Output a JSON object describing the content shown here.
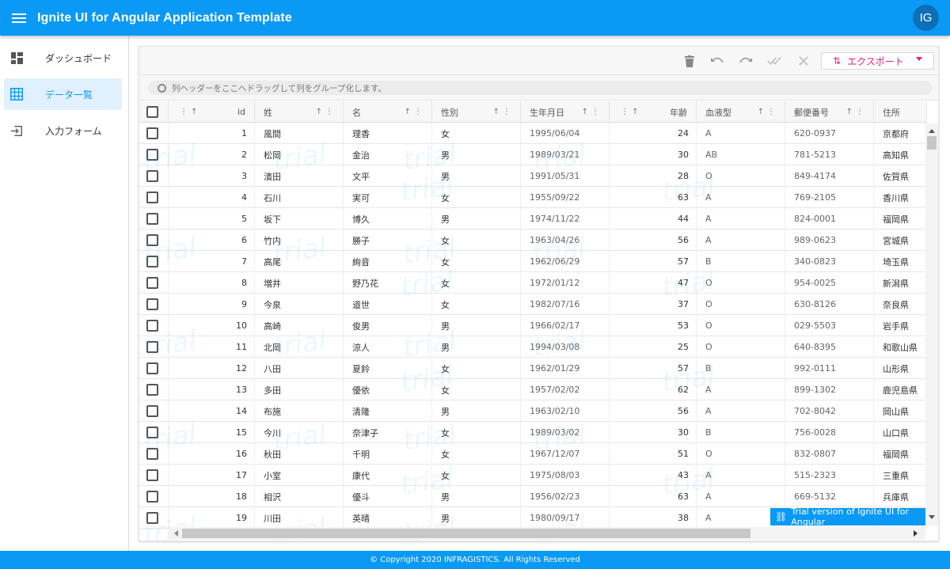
{
  "app": {
    "title": "Ignite UI for Angular Application Template",
    "avatar_initials": "IG"
  },
  "colors": {
    "primary": "#0a99f4",
    "export_accent": "#e41c77",
    "nav_active_bg": "#e1f0fd"
  },
  "sidebar": {
    "items": [
      {
        "label": "ダッシュボード",
        "icon": "dashboard-icon",
        "active": false
      },
      {
        "label": "データ一覧",
        "icon": "grid-icon",
        "active": true
      },
      {
        "label": "入力フォーム",
        "icon": "login-form-icon",
        "active": false
      }
    ]
  },
  "toolbar": {
    "icons": [
      "delete-icon",
      "undo-icon",
      "redo-icon",
      "commit-icon",
      "discard-icon"
    ],
    "export_label": "エクスポート"
  },
  "group_area": {
    "hint": "列ヘッダーをここへドラッグして列をグループ化します。"
  },
  "grid": {
    "columns": [
      {
        "key": "id",
        "label": "id"
      },
      {
        "key": "sei",
        "label": "姓"
      },
      {
        "key": "mei",
        "label": "名"
      },
      {
        "key": "gender",
        "label": "性別"
      },
      {
        "key": "birth",
        "label": "生年月日"
      },
      {
        "key": "age",
        "label": "年齢"
      },
      {
        "key": "blood",
        "label": "血液型"
      },
      {
        "key": "zip",
        "label": "郵便番号"
      },
      {
        "key": "address",
        "label": "住所"
      }
    ],
    "rows": [
      [
        "1",
        "風間",
        "理香",
        "女",
        "1995/06/04",
        "24",
        "A",
        "620-0937",
        "京都府"
      ],
      [
        "2",
        "松岡",
        "金治",
        "男",
        "1989/03/21",
        "30",
        "AB",
        "781-5213",
        "高知県"
      ],
      [
        "3",
        "濱田",
        "文平",
        "男",
        "1991/05/31",
        "28",
        "O",
        "849-4174",
        "佐賀県"
      ],
      [
        "4",
        "石川",
        "実可",
        "女",
        "1955/09/22",
        "63",
        "A",
        "769-2105",
        "香川県"
      ],
      [
        "5",
        "坂下",
        "博久",
        "男",
        "1974/11/22",
        "44",
        "A",
        "824-0001",
        "福岡県"
      ],
      [
        "6",
        "竹内",
        "勝子",
        "女",
        "1963/04/26",
        "56",
        "A",
        "989-0623",
        "宮城県"
      ],
      [
        "7",
        "高尾",
        "絢音",
        "女",
        "1962/06/29",
        "57",
        "B",
        "340-0823",
        "埼玉県"
      ],
      [
        "8",
        "増井",
        "野乃花",
        "女",
        "1972/01/12",
        "47",
        "O",
        "954-0025",
        "新潟県"
      ],
      [
        "9",
        "今泉",
        "道世",
        "女",
        "1982/07/16",
        "37",
        "O",
        "630-8126",
        "奈良県"
      ],
      [
        "10",
        "高崎",
        "俊男",
        "男",
        "1966/02/17",
        "53",
        "O",
        "029-5503",
        "岩手県"
      ],
      [
        "11",
        "北岡",
        "涼人",
        "男",
        "1994/03/08",
        "25",
        "O",
        "640-8395",
        "和歌山県"
      ],
      [
        "12",
        "八田",
        "夏鈴",
        "女",
        "1962/01/29",
        "57",
        "B",
        "992-0111",
        "山形県"
      ],
      [
        "13",
        "多田",
        "優依",
        "女",
        "1957/02/02",
        "62",
        "A",
        "899-1302",
        "鹿児島県"
      ],
      [
        "14",
        "布施",
        "清隆",
        "男",
        "1963/02/10",
        "56",
        "A",
        "702-8042",
        "岡山県"
      ],
      [
        "15",
        "今川",
        "奈津子",
        "女",
        "1989/03/02",
        "30",
        "B",
        "756-0028",
        "山口県"
      ],
      [
        "16",
        "秋田",
        "千明",
        "女",
        "1967/12/07",
        "51",
        "O",
        "832-0807",
        "福岡県"
      ],
      [
        "17",
        "小室",
        "康代",
        "女",
        "1975/08/03",
        "43",
        "A",
        "515-2323",
        "三重県"
      ],
      [
        "18",
        "相沢",
        "優斗",
        "男",
        "1956/02/23",
        "63",
        "A",
        "669-5132",
        "兵庫県"
      ],
      [
        "19",
        "川田",
        "英晴",
        "男",
        "1980/09/17",
        "38",
        "A",
        "",
        ""
      ]
    ],
    "watermark_text": "trial"
  },
  "trial_banner": "Trial version of Ignite UI for Angular",
  "footer": "© Copyright 2020 INFRAGISTICS. All Rights Reserved"
}
